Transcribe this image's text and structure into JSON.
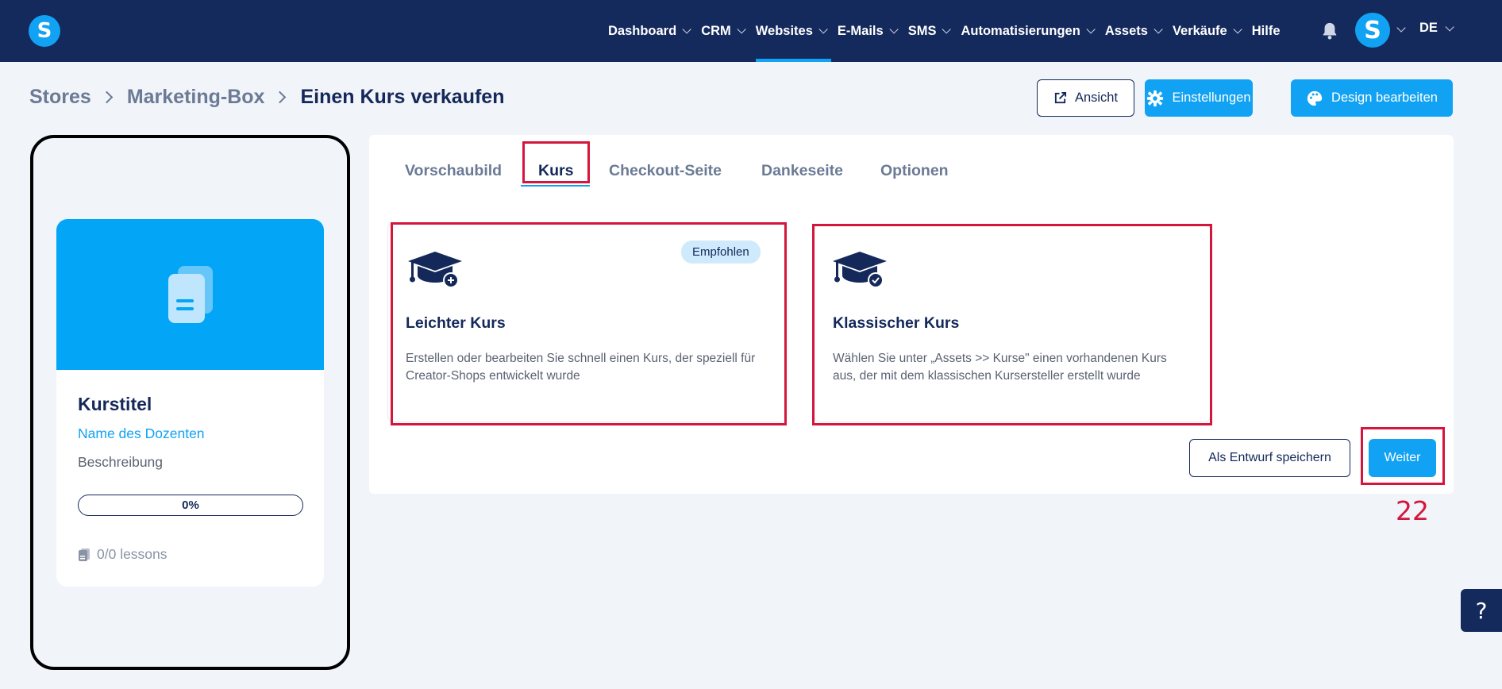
{
  "nav": {
    "logo_letter": "S",
    "items": [
      {
        "label": "Dashboard",
        "has_chevron": true
      },
      {
        "label": "CRM",
        "has_chevron": true
      },
      {
        "label": "Websites",
        "has_chevron": true,
        "active": true
      },
      {
        "label": "E-Mails",
        "has_chevron": true
      },
      {
        "label": "SMS",
        "has_chevron": true
      },
      {
        "label": "Automatisierungen",
        "has_chevron": true
      },
      {
        "label": "Assets",
        "has_chevron": true
      },
      {
        "label": "Verkäufe",
        "has_chevron": true
      },
      {
        "label": "Hilfe",
        "has_chevron": false
      }
    ],
    "notification_icon": "bell-icon",
    "avatar_letter": "S",
    "language": "DE"
  },
  "breadcrumb": {
    "items": [
      "Stores",
      "Marketing-Box",
      "Einen Kurs verkaufen"
    ]
  },
  "header_buttons": {
    "view_label": "Ansicht",
    "settings_label": "Einstellungen",
    "design_label": "Design bearbeiten"
  },
  "preview": {
    "title": "Kurstitel",
    "instructor": "Name des Dozenten",
    "description": "Beschreibung",
    "progress": "0%",
    "lessons": "0/0 lessons"
  },
  "tabs": [
    {
      "label": "Vorschaubild"
    },
    {
      "label": "Kurs",
      "active": true
    },
    {
      "label": "Checkout-Seite"
    },
    {
      "label": "Dankeseite"
    },
    {
      "label": "Optionen"
    }
  ],
  "options": {
    "easy": {
      "title": "Leichter Kurs",
      "badge": "Empfohlen",
      "desc_line1": "Erstellen oder bearbeiten Sie schnell einen Kurs, der speziell für",
      "desc_line2": "Creator-Shops entwickelt wurde"
    },
    "classic": {
      "title": "Klassischer Kurs",
      "desc_line1": "Wählen Sie unter „Assets >> Kurse\" einen vorhandenen Kurs",
      "desc_line2": "aus, der mit dem klassischen Kursersteller erstellt wurde"
    }
  },
  "footer_buttons": {
    "draft_label": "Als Entwurf speichern",
    "next_label": "Weiter"
  },
  "step_number": "22",
  "help_label": "?",
  "colors": {
    "nav_bg": "#14295c",
    "accent": "#12a2f3",
    "highlight": "#d4163c",
    "page_bg": "#f1f4f9"
  }
}
